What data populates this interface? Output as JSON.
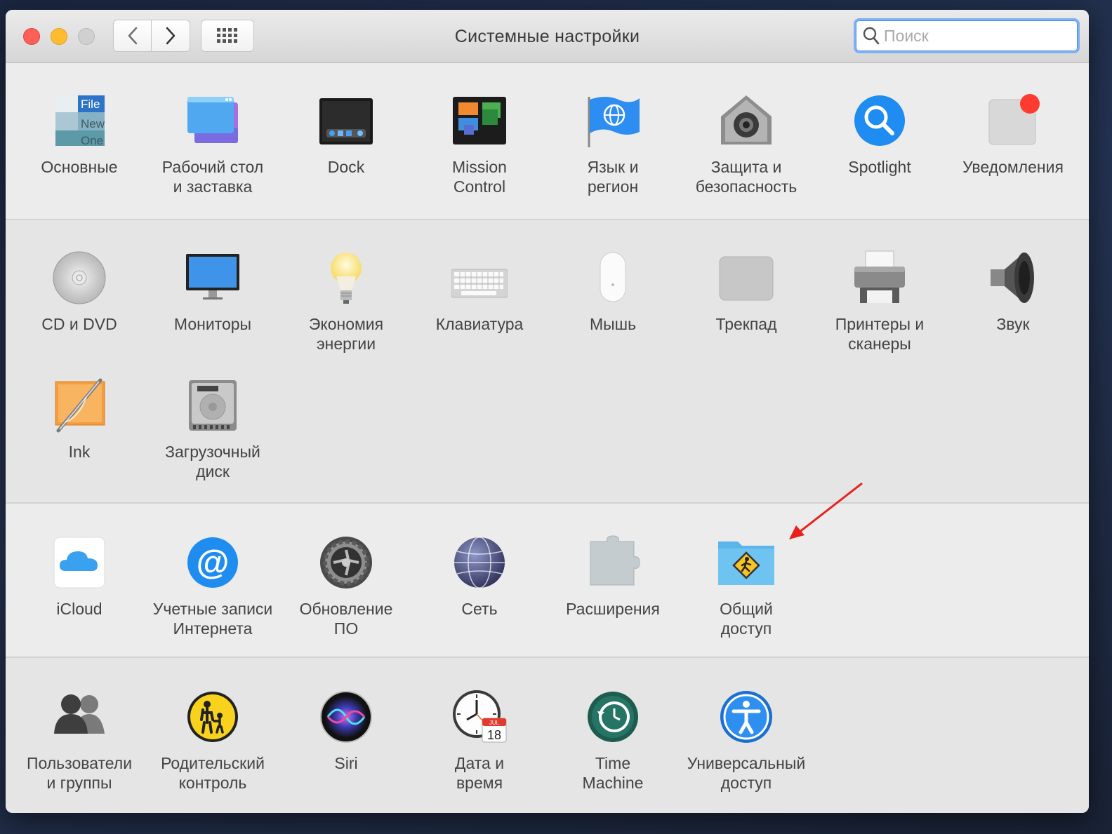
{
  "window": {
    "title": "Системные настройки"
  },
  "search": {
    "placeholder": "Поиск",
    "value": ""
  },
  "sections": [
    {
      "items": [
        {
          "id": "general",
          "label": "Основные",
          "icon": "general-icon"
        },
        {
          "id": "desktop",
          "label": "Рабочий стол\nи заставка",
          "icon": "desktop-icon"
        },
        {
          "id": "dock",
          "label": "Dock",
          "icon": "dock-icon"
        },
        {
          "id": "mission",
          "label": "Mission\nControl",
          "icon": "mission-control-icon"
        },
        {
          "id": "language",
          "label": "Язык и\nрегион",
          "icon": "language-flag-icon"
        },
        {
          "id": "security",
          "label": "Защита и\nбезопасность",
          "icon": "security-house-icon"
        },
        {
          "id": "spotlight",
          "label": "Spotlight",
          "icon": "spotlight-icon"
        },
        {
          "id": "notifications",
          "label": "Уведомления",
          "icon": "notifications-icon"
        }
      ]
    },
    {
      "items": [
        {
          "id": "cddvd",
          "label": "CD и DVD",
          "icon": "cd-dvd-icon"
        },
        {
          "id": "displays",
          "label": "Мониторы",
          "icon": "monitor-icon"
        },
        {
          "id": "energy",
          "label": "Экономия\nэнергии",
          "icon": "lightbulb-icon"
        },
        {
          "id": "keyboard",
          "label": "Клавиатура",
          "icon": "keyboard-icon"
        },
        {
          "id": "mouse",
          "label": "Мышь",
          "icon": "mouse-icon"
        },
        {
          "id": "trackpad",
          "label": "Трекпад",
          "icon": "trackpad-icon"
        },
        {
          "id": "printers",
          "label": "Принтеры и\nсканеры",
          "icon": "printer-icon"
        },
        {
          "id": "sound",
          "label": "Звук",
          "icon": "speaker-icon"
        },
        {
          "id": "ink",
          "label": "Ink",
          "icon": "ink-icon"
        },
        {
          "id": "startup",
          "label": "Загрузочный\nдиск",
          "icon": "hard-disk-icon"
        }
      ]
    },
    {
      "items": [
        {
          "id": "icloud",
          "label": "iCloud",
          "icon": "icloud-icon"
        },
        {
          "id": "internet",
          "label": "Учетные записи\nИнтернета",
          "icon": "internet-accounts-icon"
        },
        {
          "id": "update",
          "label": "Обновление\nПО",
          "icon": "software-update-gear-icon"
        },
        {
          "id": "network",
          "label": "Сеть",
          "icon": "network-globe-icon"
        },
        {
          "id": "extensions",
          "label": "Расширения",
          "icon": "extensions-puzzle-icon"
        },
        {
          "id": "sharing",
          "label": "Общий\nдоступ",
          "icon": "sharing-folder-icon"
        }
      ]
    },
    {
      "items": [
        {
          "id": "users",
          "label": "Пользователи\nи группы",
          "icon": "users-groups-icon"
        },
        {
          "id": "parental",
          "label": "Родительский\nконтроль",
          "icon": "parental-controls-icon"
        },
        {
          "id": "siri",
          "label": "Siri",
          "icon": "siri-icon"
        },
        {
          "id": "datetime",
          "label": "Дата и\nвремя",
          "icon": "clock-calendar-icon"
        },
        {
          "id": "timemachine",
          "label": "Time\nMachine",
          "icon": "time-machine-icon"
        },
        {
          "id": "accessibility",
          "label": "Универсальный\nдоступ",
          "icon": "accessibility-icon"
        }
      ]
    }
  ],
  "general_icon_text": {
    "file": "File",
    "new": "New",
    "one": "One"
  },
  "calendar_icon_text": {
    "month": "JUL",
    "day": "18"
  },
  "annotation": {
    "arrow_color": "#e8201c",
    "target": "sharing"
  }
}
